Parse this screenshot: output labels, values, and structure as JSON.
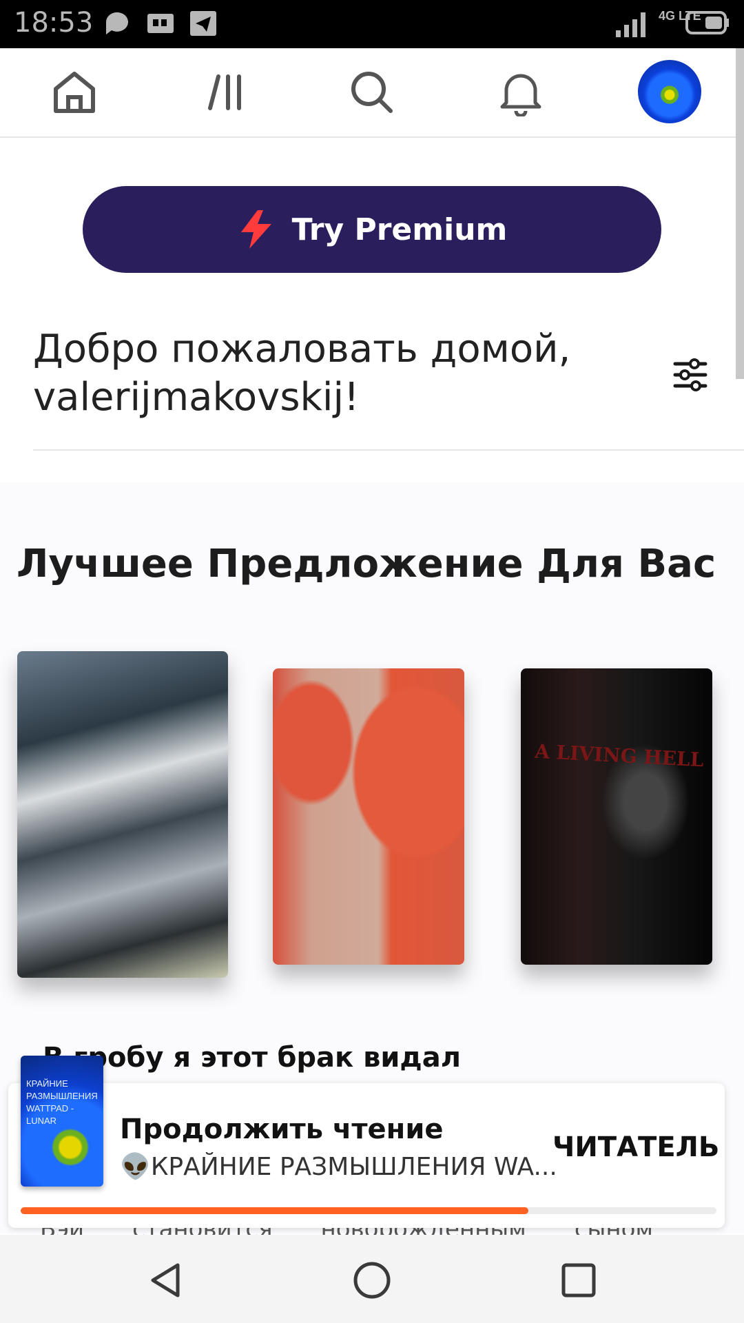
{
  "status_bar": {
    "time": "18:53",
    "network": "4G LTE"
  },
  "top_nav": {
    "items": [
      {
        "name": "home"
      },
      {
        "name": "library"
      },
      {
        "name": "search"
      },
      {
        "name": "notifications"
      },
      {
        "name": "profile"
      }
    ]
  },
  "premium": {
    "label": "Try Premium",
    "accent": "#ff3b3b",
    "bg": "#2a1e5c"
  },
  "welcome": {
    "line1": "Добро пожаловать домой,",
    "line2": "valerijmakovskij!"
  },
  "recommend": {
    "title": "Лучшее Предложение Для Вас",
    "covers": [
      {
        "name": "cover-1"
      },
      {
        "name": "cover-2"
      },
      {
        "name": "cover-3",
        "text": "A LIVING HELL"
      }
    ],
    "selected_title": "В гробу я этот брак видал",
    "description_peek": [
      "Вэй",
      "становится",
      "новорожденным",
      "сыном"
    ]
  },
  "continue_reading": {
    "cover_text": "КРАЙНИЕ РАЗМЫШЛЕНИЯ WATTPAD -LUNAR",
    "title": "Продолжить чтение",
    "book": "👽КРАЙНИЕ РАЗМЫШЛЕНИЯ WA...",
    "action": "ЧИТАТЕЛЬ",
    "progress": 0.73,
    "progress_color": "#ff6122"
  },
  "system_nav": [
    "back",
    "home",
    "recents"
  ]
}
